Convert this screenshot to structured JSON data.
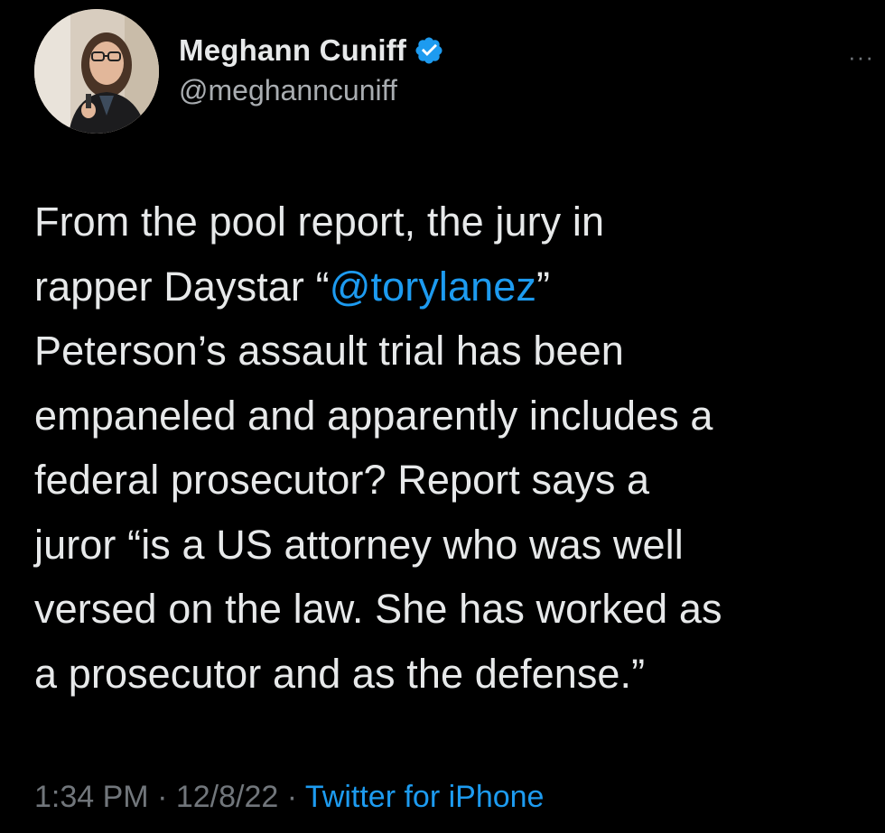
{
  "author": {
    "display_name": "Meghann Cuniff",
    "handle": "@meghanncuniff",
    "verified": true,
    "verified_color": "#1d9bf0"
  },
  "more_menu": {
    "icon": "more-horizontal-icon",
    "label": "···"
  },
  "tweet": {
    "lines": [
      {
        "text": "From the pool report, the jury in"
      },
      {
        "before": "rapper Daystar “",
        "mention": "@torylanez",
        "after": "”"
      },
      {
        "text": "Peterson’s assault trial has been"
      },
      {
        "text": "empaneled and apparently includes a"
      },
      {
        "text": "federal prosecutor? Report says a"
      },
      {
        "text": "juror “is a US attorney who was well"
      },
      {
        "text": "versed on the law. She has worked as"
      },
      {
        "text": "a prosecutor and as the defense.”"
      }
    ]
  },
  "meta": {
    "time": "1:34 PM",
    "separator": " · ",
    "date": "12/8/22",
    "source": "Twitter for iPhone"
  },
  "colors": {
    "background": "#000000",
    "text": "#e7e9ea",
    "secondary": "#71767b",
    "link": "#1d9bf0"
  }
}
